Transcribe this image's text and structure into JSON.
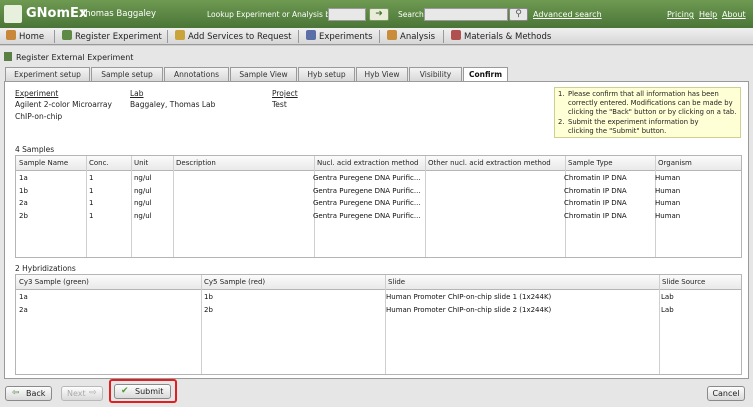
{
  "app": {
    "brand": "GNomEx",
    "user": "Thomas Baggaley"
  },
  "topbar": {
    "lookup_label": "Lookup Experiment or Analysis by #",
    "search_label": "Search",
    "advanced_search": "Advanced search",
    "pricing": "Pricing",
    "help": "Help",
    "about": "About"
  },
  "nav": {
    "home": "Home",
    "register": "Register Experiment",
    "add_services": "Add Services to Request",
    "experiments": "Experiments",
    "analysis": "Analysis",
    "materials": "Materials & Methods"
  },
  "panel": {
    "title": "Register External Experiment"
  },
  "tabs": [
    "Experiment setup",
    "Sample setup",
    "Annotations",
    "Sample View",
    "Hyb setup",
    "Hyb View",
    "Visibility",
    "Confirm"
  ],
  "summary": {
    "experiment_label": "Experiment",
    "experiment_values": [
      "Agilent 2-color Microarray",
      "ChIP-on-chip"
    ],
    "lab_label": "Lab",
    "lab_value": "Baggaley, Thomas Lab",
    "project_label": "Project",
    "project_value": "Test"
  },
  "info": {
    "item1_num": "1.",
    "item1_lines": [
      "Please confirm that all information has been",
      "correctly entered. Modifications can be made by",
      "clicking the \"Back\" button or by clicking on a tab."
    ],
    "item2_num": "2.",
    "item2_lines": [
      "Submit the experiment information by",
      "clicking the \"Submit\" button."
    ]
  },
  "samples": {
    "title": "4 Samples",
    "columns": [
      "Sample Name",
      "Conc.",
      "Unit",
      "Description",
      "Nucl. acid extraction method",
      "Other nucl. acid extraction method",
      "Sample Type",
      "Organism"
    ],
    "rows": [
      [
        "1a",
        "1",
        "ng/ul",
        "",
        "Gentra Puregene DNA Purific...",
        "",
        "Chromatin IP DNA",
        "Human"
      ],
      [
        "1b",
        "1",
        "ng/ul",
        "",
        "Gentra Puregene DNA Purific...",
        "",
        "Chromatin IP DNA",
        "Human"
      ],
      [
        "2a",
        "1",
        "ng/ul",
        "",
        "Gentra Puregene DNA Purific...",
        "",
        "Chromatin IP DNA",
        "Human"
      ],
      [
        "2b",
        "1",
        "ng/ul",
        "",
        "Gentra Puregene DNA Purific...",
        "",
        "Chromatin IP DNA",
        "Human"
      ]
    ]
  },
  "hybs": {
    "title": "2 Hybridizations",
    "columns": [
      "Cy3 Sample (green)",
      "Cy5 Sample (red)",
      "Slide",
      "Slide Source"
    ],
    "rows": [
      [
        "1a",
        "1b",
        "Human Promoter ChIP-on-chip slide 1 (1x244K)",
        "Lab"
      ],
      [
        "2a",
        "2b",
        "Human Promoter ChIP-on-chip slide 2 (1x244K)",
        "Lab"
      ]
    ]
  },
  "buttons": {
    "back": "Back",
    "next": "Next",
    "submit": "Submit",
    "cancel": "Cancel"
  }
}
